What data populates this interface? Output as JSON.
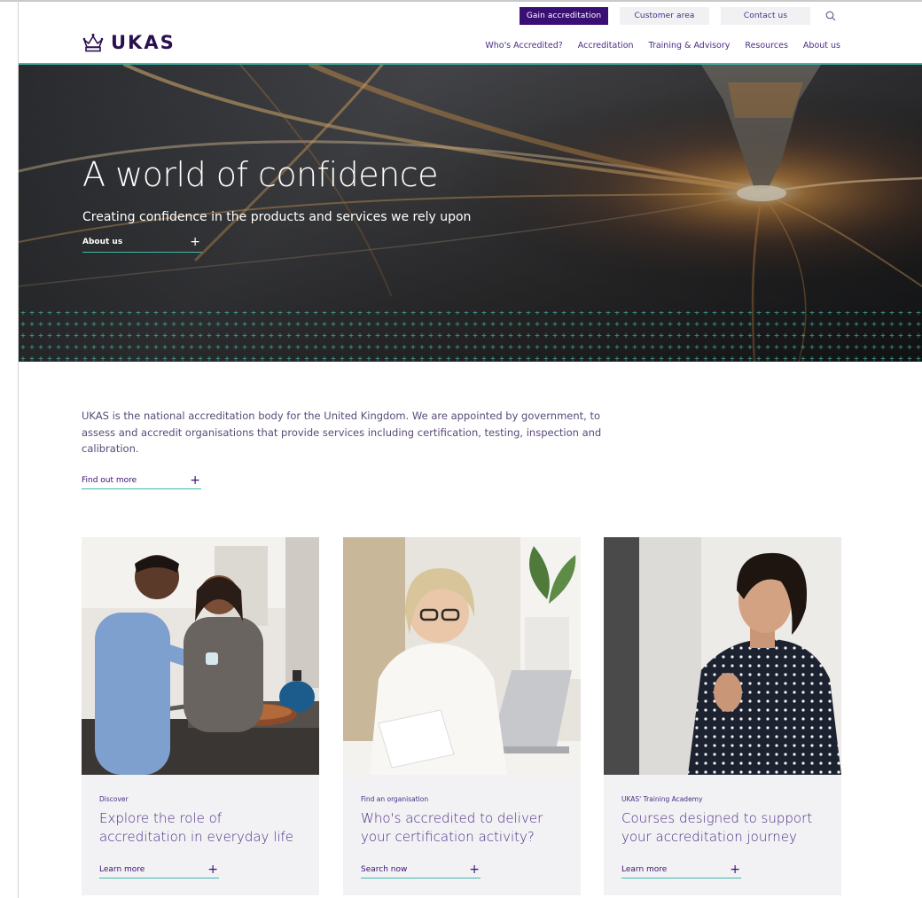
{
  "utility_bar": {
    "gain_accreditation": "Gain accreditation",
    "customer_area": "Customer area",
    "contact_us": "Contact us"
  },
  "logo": {
    "text": "UKAS"
  },
  "nav": {
    "items": [
      "Who's Accredited?",
      "Accreditation",
      "Training & Advisory",
      "Resources",
      "About us"
    ]
  },
  "hero": {
    "title": "A world of confidence",
    "subtitle": "Creating confidence in the products and services we rely upon",
    "link_label": "About us"
  },
  "intro": {
    "text": "UKAS is the national accreditation body for the United Kingdom. We are appointed by government, to assess and accredit organisations that provide services including certification, testing, inspection and calibration.",
    "link_label": "Find out more"
  },
  "cards": [
    {
      "eyebrow": "Discover",
      "title": "Explore the role of accreditation in everyday life",
      "link_label": "Learn more"
    },
    {
      "eyebrow": "Find an organisation",
      "title": "Who's accredited to deliver your certification activity?",
      "link_label": "Search now"
    },
    {
      "eyebrow": "UKAS' Training Academy",
      "title": "Courses designed to support your accreditation journey",
      "link_label": "Learn more"
    }
  ],
  "colors": {
    "brand_purple": "#3a0f73",
    "accent_teal": "#3fb8a8",
    "card_bg": "#f2f2f4"
  },
  "icons": {
    "search": "search-icon",
    "plus": "plus-icon",
    "crown": "crown-icon"
  }
}
